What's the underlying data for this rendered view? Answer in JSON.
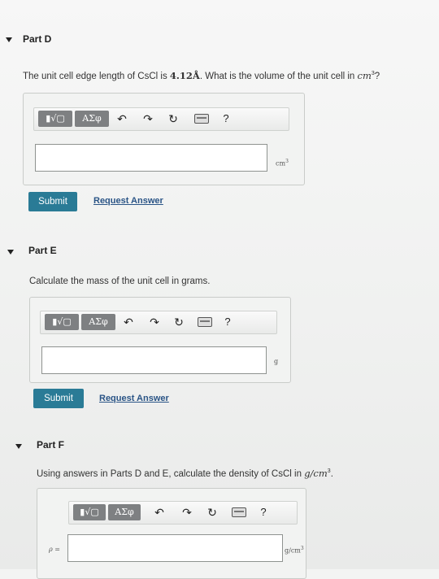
{
  "parts": [
    {
      "title": "Part D",
      "question_pre": "The unit cell edge length of CsCl is ",
      "question_value": "4.12Å",
      "question_mid": ". What is the volume of the unit cell in ",
      "question_unit": "cm",
      "question_sup": "3",
      "question_post": "?",
      "unit_label": "cm",
      "unit_sup": "3",
      "submit_label": "Submit",
      "request_label": "Request Answer"
    },
    {
      "title": "Part E",
      "question_pre": "Calculate the mass of the unit cell in grams.",
      "unit_label": "g",
      "submit_label": "Submit",
      "request_label": "Request Answer"
    },
    {
      "title": "Part F",
      "question_pre": "Using answers in Parts D and E, calculate the density of CsCl in ",
      "question_unit": "g/cm",
      "question_sup": "3",
      "question_post": ".",
      "answer_prefix": "ρ =",
      "unit_label": "g/cm",
      "unit_sup": "3"
    }
  ],
  "toolbar": {
    "templates_glyph": "▮√▢",
    "greek_label": "ΑΣφ",
    "undo_icon": "undo-icon",
    "redo_icon": "redo-icon",
    "reset_icon": "reset-icon",
    "keyboard_icon": "keyboard-icon",
    "help_label": "?"
  }
}
